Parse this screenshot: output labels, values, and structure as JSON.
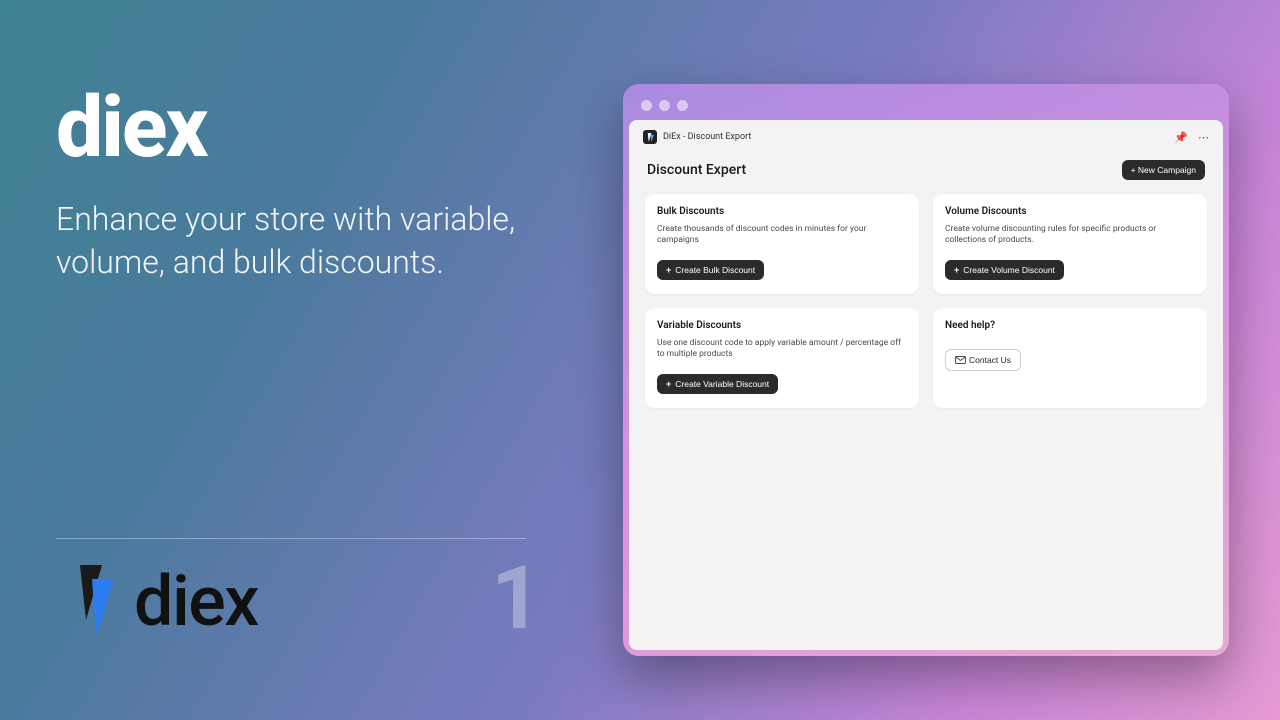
{
  "brand": "diex",
  "tagline": "Enhance your store with variable, volume, and bulk discounts.",
  "slide_number": "1",
  "logo_text": "diex",
  "window": {
    "breadcrumb": "DiEx - Discount Export",
    "page_title": "Discount Expert",
    "new_campaign_label": "+ New Campaign",
    "cards": {
      "bulk": {
        "title": "Bulk Discounts",
        "desc": "Create thousands of discount codes in minutes for your campaigns",
        "button": "Create Bulk Discount"
      },
      "volume": {
        "title": "Volume Discounts",
        "desc": "Create volume discounting rules for specific products or collections of products.",
        "button": "Create Volume Discount"
      },
      "variable": {
        "title": "Variable Discounts",
        "desc": "Use one discount code to apply variable amount / percentage off to multiple products",
        "button": "Create Variable Discount"
      },
      "help": {
        "title": "Need help?",
        "desc": "",
        "button": "Contact Us"
      }
    }
  }
}
